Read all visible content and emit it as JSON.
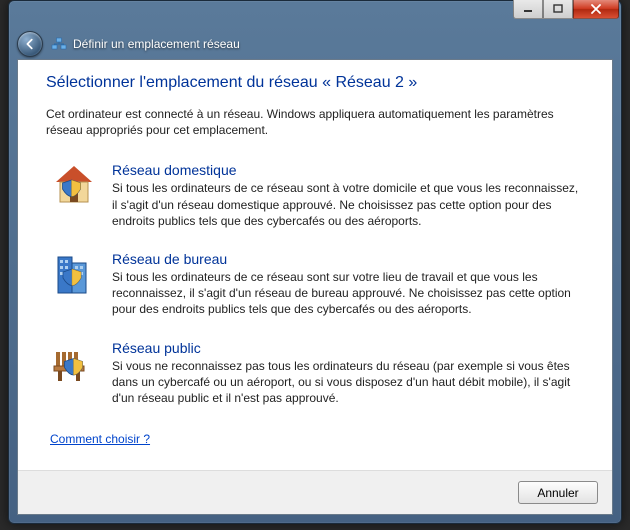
{
  "window": {
    "wizard_title": "Définir un emplacement réseau"
  },
  "heading": "Sélectionner l'emplacement du réseau « Réseau  2 »",
  "intro": "Cet ordinateur est connecté à un réseau. Windows appliquera automatiquement les paramètres réseau appropriés pour cet emplacement.",
  "options": {
    "home": {
      "title": "Réseau domestique",
      "desc": "Si tous les ordinateurs de ce réseau sont à votre domicile et que vous les reconnaissez, il s'agit d'un réseau domestique approuvé. Ne choisissez pas cette option pour des endroits publics tels que des cybercafés ou des aéroports."
    },
    "work": {
      "title": "Réseau de bureau",
      "desc": "Si tous les ordinateurs de ce réseau sont sur votre lieu de travail et que vous les reconnaissez, il s'agit d'un réseau de bureau approuvé. Ne choisissez pas cette option pour des endroits publics tels que des cybercafés ou des aéroports."
    },
    "public": {
      "title": "Réseau public",
      "desc": "Si vous ne reconnaissez pas tous les ordinateurs du réseau (par exemple si vous êtes dans un cybercafé ou un aéroport, ou si vous disposez d'un haut débit mobile), il s'agit d'un réseau public et il n'est pas approuvé."
    }
  },
  "help_link": "Comment choisir ?",
  "buttons": {
    "cancel": "Annuler"
  }
}
